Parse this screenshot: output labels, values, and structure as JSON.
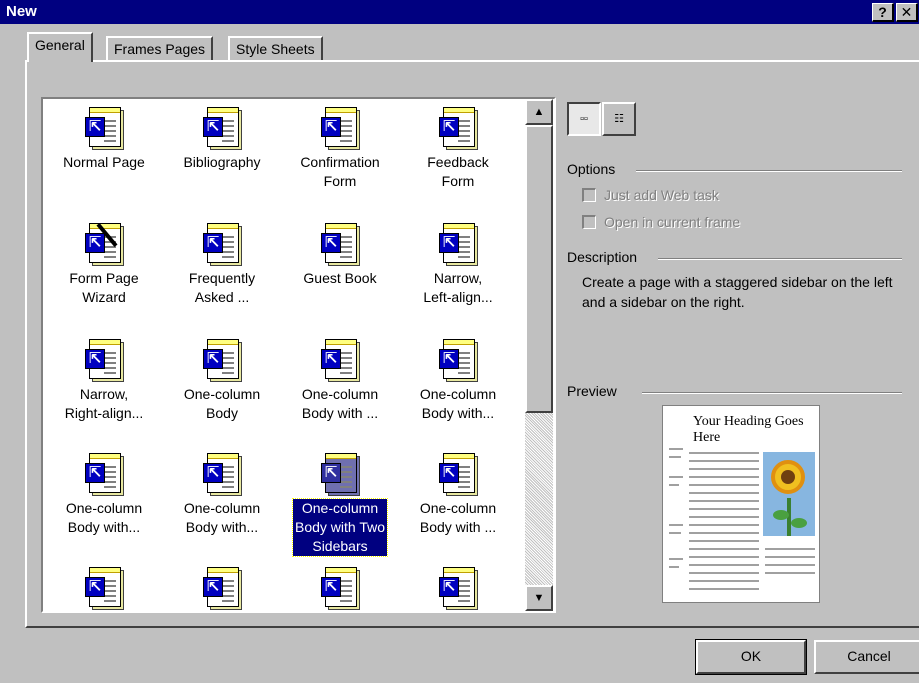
{
  "window": {
    "title": "New",
    "help_label": "?",
    "close_label": "✕"
  },
  "tabs": [
    {
      "label": "General",
      "active": true
    },
    {
      "label": "Frames Pages",
      "active": false
    },
    {
      "label": "Style Sheets",
      "active": false
    }
  ],
  "templates": [
    {
      "label": "Normal Page",
      "icon": "page-template-icon"
    },
    {
      "label": "Bibliography",
      "icon": "page-template-icon"
    },
    {
      "label": "Confirmation\nForm",
      "icon": "page-template-icon"
    },
    {
      "label": "Feedback\nForm",
      "icon": "page-template-icon"
    },
    {
      "label": "Form Page\nWizard",
      "icon": "wizard-template-icon"
    },
    {
      "label": "Frequently\nAsked ...",
      "icon": "page-template-icon"
    },
    {
      "label": "Guest Book",
      "icon": "page-template-icon"
    },
    {
      "label": "Narrow,\nLeft-align...",
      "icon": "page-template-icon"
    },
    {
      "label": "Narrow,\nRight-align...",
      "icon": "page-template-icon"
    },
    {
      "label": "One-column\nBody",
      "icon": "page-template-icon"
    },
    {
      "label": "One-column\nBody with ...",
      "icon": "page-template-icon"
    },
    {
      "label": "One-column\nBody with...",
      "icon": "page-template-icon"
    },
    {
      "label": "One-column\nBody with...",
      "icon": "page-template-icon"
    },
    {
      "label": "One-column\nBody with...",
      "icon": "page-template-icon"
    },
    {
      "label": "One-column\nBody with Two\nSidebars",
      "icon": "page-template-icon",
      "selected": true
    },
    {
      "label": "One-column\nBody with ...",
      "icon": "page-template-icon"
    },
    {
      "label": "",
      "icon": "page-template-icon"
    },
    {
      "label": "",
      "icon": "page-template-icon"
    },
    {
      "label": "",
      "icon": "page-template-icon"
    },
    {
      "label": "",
      "icon": "page-template-icon"
    }
  ],
  "options": {
    "heading": "Options",
    "just_add_web_task": "Just add Web task",
    "open_in_current_frame": "Open in current frame"
  },
  "description": {
    "heading": "Description",
    "text": "Create a page with a staggered sidebar on the left and a sidebar on the right."
  },
  "preview": {
    "heading": "Preview",
    "page_heading": "Your Heading Goes Here"
  },
  "buttons": {
    "ok": "OK",
    "cancel": "Cancel"
  },
  "colors": {
    "titlebar": "#000080",
    "face": "#c0c0c0",
    "selection": "#000080"
  }
}
